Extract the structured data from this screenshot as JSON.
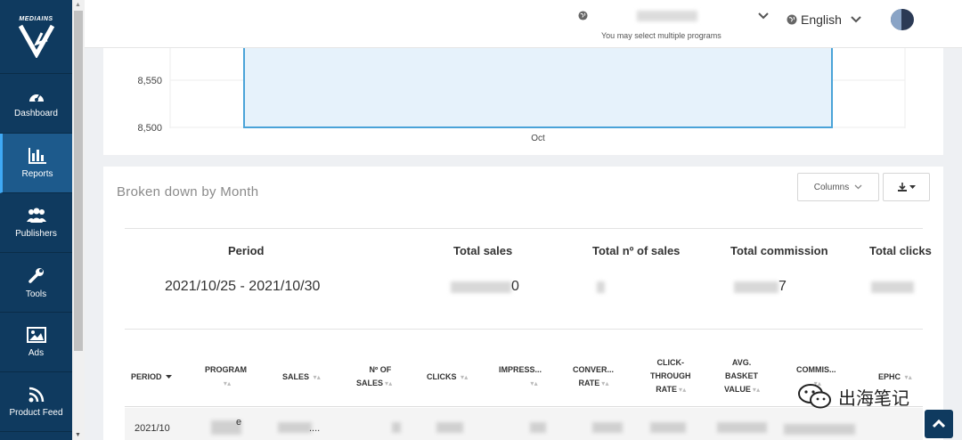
{
  "sidebar": {
    "logo_text": "MEDIAINS",
    "items": [
      {
        "label": "Dashboard",
        "icon": "dashboard-icon"
      },
      {
        "label": "Reports",
        "icon": "bar-chart-icon",
        "active": true
      },
      {
        "label": "Publishers",
        "icon": "users-icon"
      },
      {
        "label": "Tools",
        "icon": "wrench-icon"
      },
      {
        "label": "Ads",
        "icon": "image-icon"
      },
      {
        "label": "Product Feed",
        "icon": "rss-icon"
      }
    ]
  },
  "topbar": {
    "program_hint": "You may select multiple programs",
    "language": "English"
  },
  "chart_data": {
    "type": "bar",
    "categories": [
      "Oct"
    ],
    "y_ticks": [
      "8,550",
      "8,500"
    ],
    "x_label": "Oct"
  },
  "report": {
    "title": "Broken down by Month",
    "columns_button": "Columns",
    "summary": {
      "headers": {
        "period": "Period",
        "total_sales": "Total sales",
        "total_num_sales": "Total nº of sales",
        "total_commission": "Total commission",
        "total_clicks": "Total clicks"
      },
      "period_value": "2021/10/25 - 2021/10/30",
      "total_sales_tail": "0",
      "total_commission_tail": "7"
    },
    "detail": {
      "headers": {
        "period": "PERIOD",
        "program": "PROGRAM",
        "sales": "SALES",
        "num_of": "Nº OF",
        "num_sales": "SALES",
        "clicks": "CLICKS",
        "impressions": "IMPRESS...",
        "conver": "CONVER...",
        "rate": "RATE",
        "click": "CLICK-",
        "through": "THROUGH",
        "ctr_rate": "RATE",
        "avg": "AVG.",
        "basket": "BASKET",
        "value": "VALUE",
        "commission": "COMMIS...",
        "ephc": "EPHC"
      },
      "row": {
        "period": "2021/10",
        "program_char": "e",
        "sales_dots": "...."
      }
    }
  },
  "watermark": "出海笔记",
  "colors": {
    "sidebar": "#0f3a5f",
    "active": "#1d5a8c",
    "bar_fill": "#e6f2fb",
    "bar_stroke": "#4aa3d8"
  }
}
